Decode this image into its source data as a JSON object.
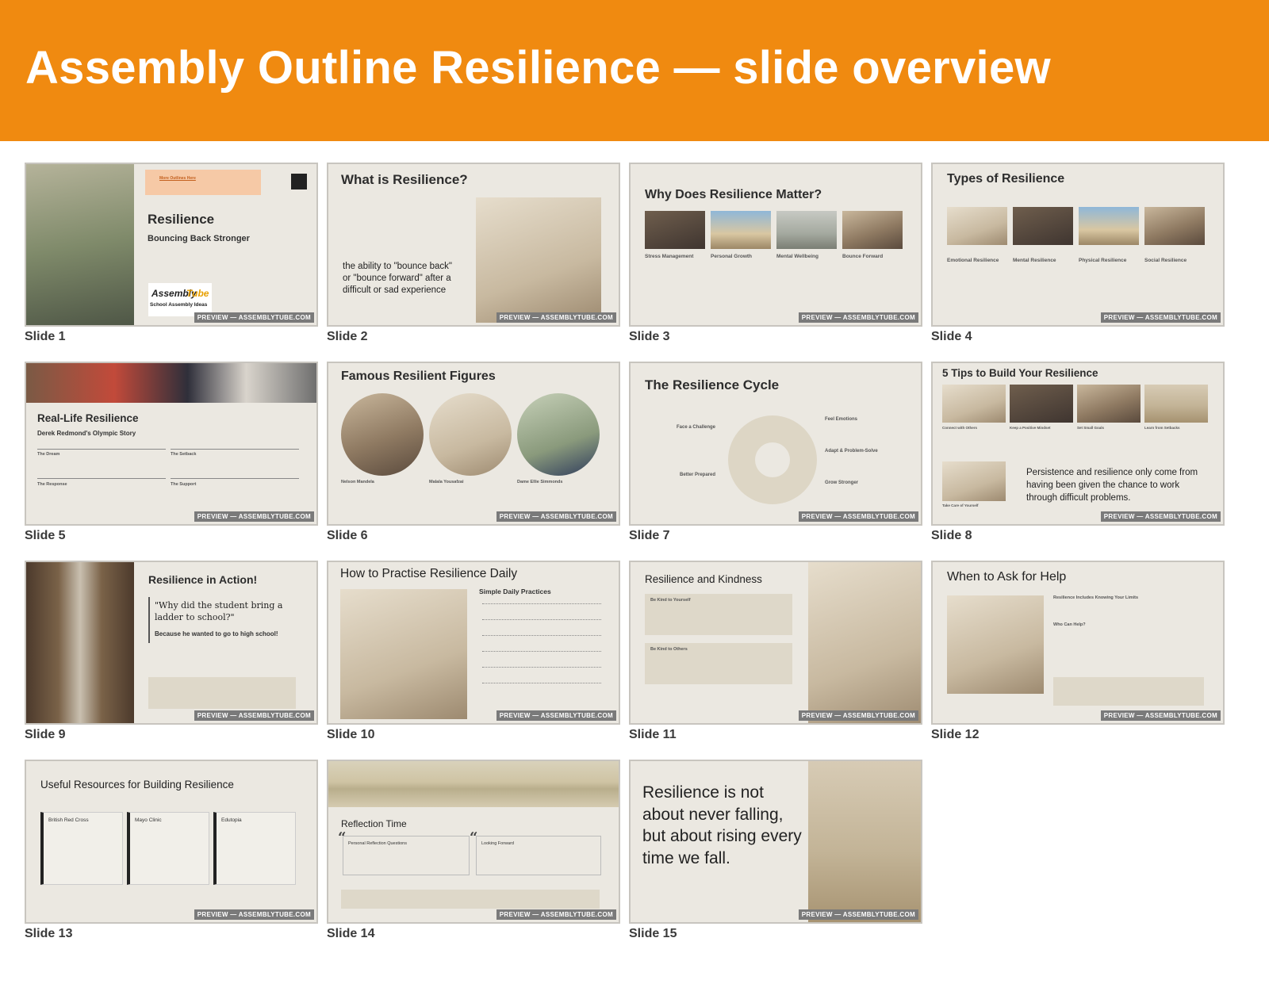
{
  "header": {
    "title": "Assembly Outline Resilience — slide overview"
  },
  "preview_label": "PREVIEW — ASSEMBLYTUBE.COM",
  "slides": [
    {
      "caption": "Slide 1",
      "title": "Resilience",
      "subtitle": "Bouncing Back Stronger",
      "link": "More Outlines Here",
      "logo_top": "Assembly",
      "logo_bottom": "Tube",
      "logo_line": "School Assembly Ideas"
    },
    {
      "caption": "Slide 2",
      "title": "What is Resilience?",
      "quote": "the ability to \"bounce back\" or \"bounce forward\" after a difficult or sad experience"
    },
    {
      "caption": "Slide 3",
      "title": "Why Does Resilience Matter?",
      "items": [
        "Stress Management",
        "Personal Growth",
        "Mental Wellbeing",
        "Bounce Forward"
      ]
    },
    {
      "caption": "Slide 4",
      "title": "Types of Resilience",
      "items": [
        "Emotional Resilience",
        "Mental Resilience",
        "Physical Resilience",
        "Social Resilience"
      ]
    },
    {
      "caption": "Slide 5",
      "title": "Real-Life Resilience",
      "subtitle": "Derek Redmond's Olympic Story",
      "items": [
        "The Dream",
        "The Setback",
        "The Response",
        "The Support"
      ]
    },
    {
      "caption": "Slide 6",
      "title": "Famous Resilient Figures",
      "items": [
        "Nelson Mandela",
        "Malala Yousafzai",
        "Dame Ellie Simmonds"
      ]
    },
    {
      "caption": "Slide 7",
      "title": "The Resilience Cycle",
      "items": [
        "Face a Challenge",
        "Feel Emotions",
        "Adapt & Problem-Solve",
        "Grow Stronger",
        "Better Prepared"
      ]
    },
    {
      "caption": "Slide 8",
      "title": "5 Tips to Build Your Resilience",
      "items": [
        "Connect with Others",
        "Keep a Positive Mindset",
        "Set Small Goals",
        "Learn from Setbacks",
        "Take Care of Yourself"
      ],
      "quote": "Persistence and resilience only come from having been given the chance to work through difficult problems."
    },
    {
      "caption": "Slide 9",
      "title": "Resilience in Action!",
      "joke": "\"Why did the student bring a ladder to school?\"",
      "answer": "Because he wanted to go to high school!"
    },
    {
      "caption": "Slide 10",
      "title": "How to Practise Resilience Daily",
      "subtitle": "Simple Daily Practices"
    },
    {
      "caption": "Slide 11",
      "title": "Resilience and Kindness",
      "items": [
        "Be Kind to Yourself",
        "Be Kind to Others"
      ]
    },
    {
      "caption": "Slide 12",
      "title": "When to Ask for Help",
      "subtitle": "Resilience Includes Knowing Your Limits",
      "heading2": "Who Can Help?"
    },
    {
      "caption": "Slide 13",
      "title": "Useful Resources for Building Resilience",
      "items": [
        "British Red Cross",
        "Mayo Clinic",
        "Edutopia"
      ]
    },
    {
      "caption": "Slide 14",
      "title": "Reflection Time",
      "items": [
        "Personal Reflection Questions",
        "Looking Forward"
      ]
    },
    {
      "caption": "Slide 15",
      "title": "Resilience is not about never falling, but about rising every time we fall."
    }
  ],
  "colors": {
    "header": "#f08a10",
    "slide_bg": "#ebe8e1"
  }
}
